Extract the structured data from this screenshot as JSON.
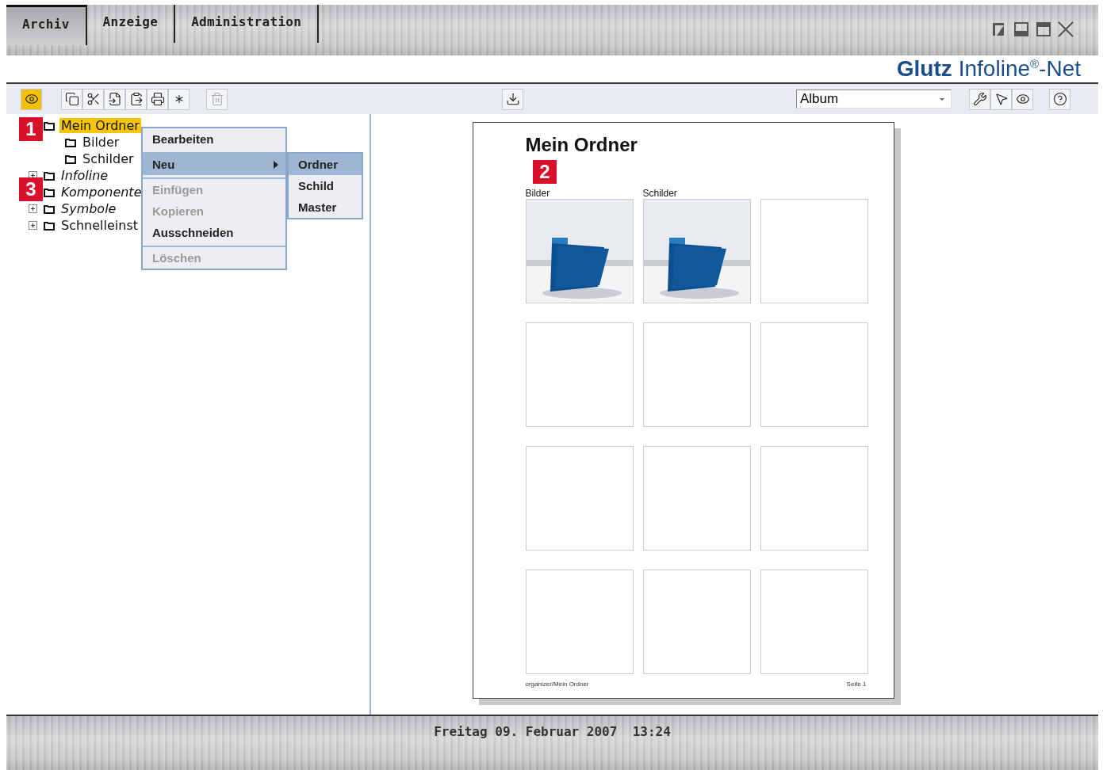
{
  "menu_tabs": [
    {
      "label": "Archiv",
      "selected": true
    },
    {
      "label": "Anzeige",
      "selected": false
    },
    {
      "label": "Administration",
      "selected": false
    }
  ],
  "brand": {
    "name": "Glutz",
    "product": "Infoline$^{®}$-Net"
  },
  "toolbar": {
    "view_active": true,
    "delete_disabled": true,
    "view_select": {
      "value": "Album"
    }
  },
  "tree": [
    {
      "label": "Mein Ordner",
      "selected": true,
      "italic": false,
      "expanded": true,
      "children": [
        {
          "label": "Bilder",
          "selected": false,
          "italic": false
        },
        {
          "label": "Schilder",
          "selected": false,
          "italic": false
        }
      ]
    },
    {
      "label": "Infoline",
      "selected": false,
      "italic": true,
      "expanded": false
    },
    {
      "label": "Komponente",
      "selected": false,
      "italic": true,
      "expanded": false
    },
    {
      "label": "Symbole",
      "selected": false,
      "italic": true,
      "expanded": false
    },
    {
      "label": "Schnelleinst",
      "selected": false,
      "italic": false,
      "expanded": false
    }
  ],
  "context_menu": {
    "items": [
      {
        "label": "Bearbeiten",
        "disabled": false,
        "selected": false,
        "submenu": false
      },
      {
        "label": "Neu",
        "disabled": false,
        "selected": true,
        "submenu": true
      },
      {
        "label": "Einfügen",
        "disabled": true,
        "selected": false,
        "submenu": false
      },
      {
        "label": "Kopieren",
        "disabled": true,
        "selected": false,
        "submenu": false
      },
      {
        "label": "Ausschneiden",
        "disabled": false,
        "selected": false,
        "submenu": false
      },
      {
        "label": "Löschen",
        "disabled": true,
        "selected": false,
        "submenu": false
      }
    ],
    "submenu": [
      {
        "label": "Ordner",
        "selected": true
      },
      {
        "label": "Schild",
        "selected": false
      },
      {
        "label": "Master",
        "selected": false
      }
    ]
  },
  "album_page": {
    "title": "Mein Ordner",
    "cells": [
      {
        "label": "Bilder",
        "kind": "picture"
      },
      {
        "label": "Schilder",
        "kind": "picture"
      },
      {
        "kind": "empty"
      },
      {
        "kind": "empty"
      },
      {
        "kind": "empty"
      },
      {
        "kind": "empty"
      },
      {
        "kind": "empty"
      },
      {
        "kind": "empty"
      },
      {
        "kind": "empty"
      },
      {
        "kind": "empty"
      },
      {
        "kind": "empty"
      },
      {
        "kind": "empty"
      }
    ],
    "footer_path": "organizer/Mein Ordner",
    "footer_page": "Seite 1"
  },
  "callouts": [
    "1",
    "2",
    "3"
  ],
  "status_bar": {
    "text": "Freitag 09. Februar 2007  13:24"
  }
}
